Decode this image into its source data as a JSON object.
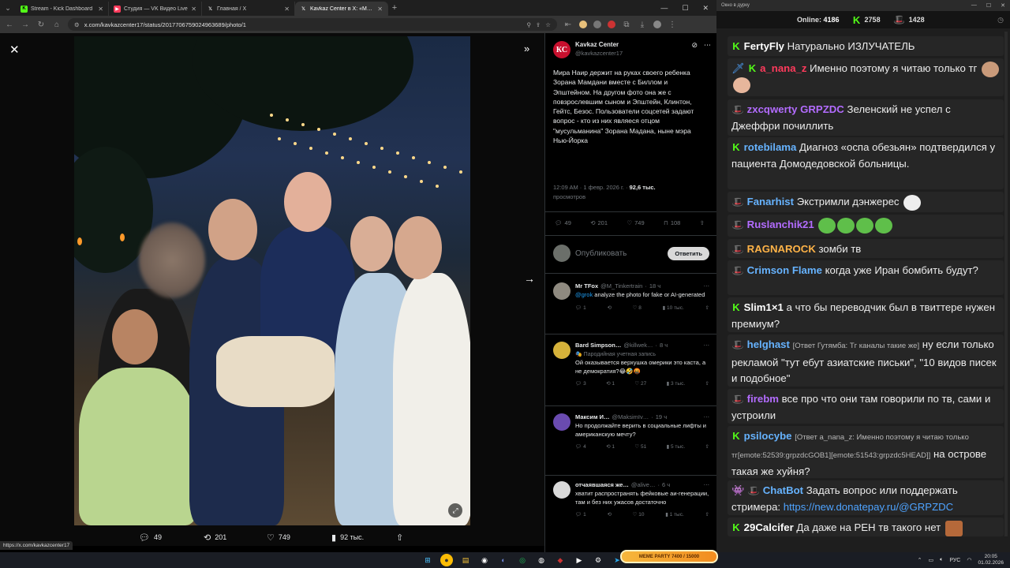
{
  "browser": {
    "tabs": [
      {
        "title": "Stream - Kick Dashboard",
        "fav": "K",
        "color": "#53fc18"
      },
      {
        "title": "Студия — VK Видео Live",
        "fav": "VK",
        "color": "#ff3b5c"
      },
      {
        "title": "Главная / X",
        "fav": "X",
        "color": "#ffffff"
      },
      {
        "title": "Kavkaz Center в X: «Мира Наи…",
        "fav": "X",
        "color": "#ffffff"
      }
    ],
    "url": "x.com/kavkazcenter17/status/2017706759024963689/photo/1",
    "status_link": "https://x.com/kavkazcenter17"
  },
  "photo_actions": {
    "replies": "49",
    "reposts": "201",
    "likes": "749",
    "views": "92 тыс."
  },
  "tweet": {
    "author_name": "Kavkaz Center",
    "author_handle": "@kavkazcenter17",
    "logo_text": "КС",
    "text": "Мира Наир держит на руках своего ребенка Зорана Мамдани вместе с Биллом и Эпштейном. На другом фото она же с повзрослевшим сыном и Эпштейн, Клинтон, Гейтс, Безос. Пользователи соцсетей задают вопрос - кто из них являеся отцом \"мусульманина\" Зорана Мадана, ныне мэра Нью-Йорка",
    "time": "12:09 AM · 1 февр. 2026 г. · ",
    "views_count": "92,6 тыс.",
    "views_label": "просмотров",
    "stats": {
      "replies": "49",
      "reposts": "201",
      "likes": "749",
      "bookmarks": "108"
    },
    "reply_placeholder": "Опубликовать",
    "reply_button": "Ответить"
  },
  "comments": [
    {
      "name": "Mr TFox",
      "handle": "@M_Tinkertrain",
      "time": "18 ч",
      "badge": "",
      "mention": "@grok",
      "text": " analyze the photo for fake or AI-generated",
      "replies": "1",
      "reposts": "",
      "likes": "8",
      "views": "10 тыс.",
      "avatar": "#8f8a80"
    },
    {
      "name": "Bard Simpson…",
      "handle": "@killwek…",
      "time": "8 ч",
      "badge": "🎭 Пародийная учетная запись",
      "mention": "",
      "text": "Ой оказывается верхушка омерики это каста, а не демократия?😂🤣🤬",
      "replies": "3",
      "reposts": "1",
      "likes": "27",
      "views": "3 тыс.",
      "avatar": "#d6b23a"
    },
    {
      "name": "Максим И…",
      "handle": "@MaksimIv…",
      "time": "19 ч",
      "badge": "",
      "mention": "",
      "text": "Но продолжайте верить в социальные лифты и американскую мечту?",
      "replies": "4",
      "reposts": "1",
      "likes": "51",
      "views": "5 тыс.",
      "avatar": "#6a4bb0"
    },
    {
      "name": "отчаявшаяся же…",
      "handle": "@alive…",
      "time": "6 ч",
      "badge": "",
      "mention": "",
      "text": "хватит распространять фейковые аи-генерации, там и без них ужасов достаточно",
      "replies": "1",
      "reposts": "",
      "likes": "10",
      "views": "1 тыс.",
      "avatar": "#d9d9d9"
    }
  ],
  "chat": {
    "title": "Окно в дурку",
    "online_label": "Online:",
    "online_count": "4186",
    "kick_count": "2758",
    "vk_count": "1428",
    "messages": [
      {
        "platform": "kick",
        "user": "FertyFly",
        "color": "#ffffff",
        "reply": "",
        "text": "Натурально ИЗЛУЧАТЕЛЬ"
      },
      {
        "platform": "kick",
        "user": "a_nana_z",
        "color": "#ff3b5c",
        "reply": "",
        "text": "Именно поэтому я читаю только тг"
      },
      {
        "platform": "vk",
        "user": "zxcqwerty",
        "color": "#b36cff",
        "extra_user": "GRPZDC",
        "reply": "",
        "text": "Зеленский не успел с Джеффри почиллить"
      },
      {
        "platform": "kick",
        "user": "rotebilama",
        "color": "#66b3ff",
        "reply": "",
        "text": "Диагноз «оспа обезьян» подтвердился у пациента Домодедовской больницы."
      },
      {
        "platform": "vk",
        "user": "Fanarhist",
        "color": "#66b3ff",
        "reply": "",
        "text": "Экстримли дэнжерес"
      },
      {
        "platform": "vk",
        "user": "Ruslanchik21",
        "color": "#b36cff",
        "reply": "",
        "text": ""
      },
      {
        "platform": "vk",
        "user": "RAGNAROCK",
        "color": "#ffb347",
        "reply": "",
        "text": "зомби тв"
      },
      {
        "platform": "vk",
        "user": "Crimson Flame",
        "color": "#66b3ff",
        "reply": "",
        "text": "когда уже Иран бомбить будут?"
      },
      {
        "platform": "kick",
        "user": "Slim1×1",
        "color": "#ffffff",
        "reply": "",
        "text": "а что бы переводчик был в твиттере нужен премиум?"
      },
      {
        "platform": "vk",
        "user": "helghast",
        "color": "#66b3ff",
        "reply": "[Ответ Гутямба: Тг каналы такие же]",
        "text": "ну если только рекламой \"тут ебут азиатские письки\", \"10 видов писек и подобное\""
      },
      {
        "platform": "vk",
        "user": "firebm",
        "color": "#b36cff",
        "reply": "",
        "text": "все про что они там говорили по тв, сами и устроили"
      },
      {
        "platform": "kick",
        "user": "psilocybe",
        "color": "#66b3ff",
        "reply": "[Ответ a_nana_z: Именно поэтому я читаю только тг[emote:52539:grpzdcGOB1][emote:51543:grpzdc5HEAD]]",
        "text": "на острове такая же хуйня?"
      },
      {
        "platform": "bot",
        "user": "ChatBot",
        "color": "#66b3ff",
        "reply": "",
        "text": "Задать вопрос или поддержать стримера: ",
        "link": "https://new.donatepay.ru/@GRPZDC"
      },
      {
        "platform": "kick",
        "user": "29Calcifer",
        "color": "#ffffff",
        "reply": "",
        "text": "Да даже на РЕН тв такого нет"
      }
    ]
  },
  "taskbar": {
    "meme_party": "MEME PARTY",
    "meme_progress": "7400 / 15000",
    "lang": "РУС",
    "time": "20:05",
    "date": "01.02.2026"
  }
}
